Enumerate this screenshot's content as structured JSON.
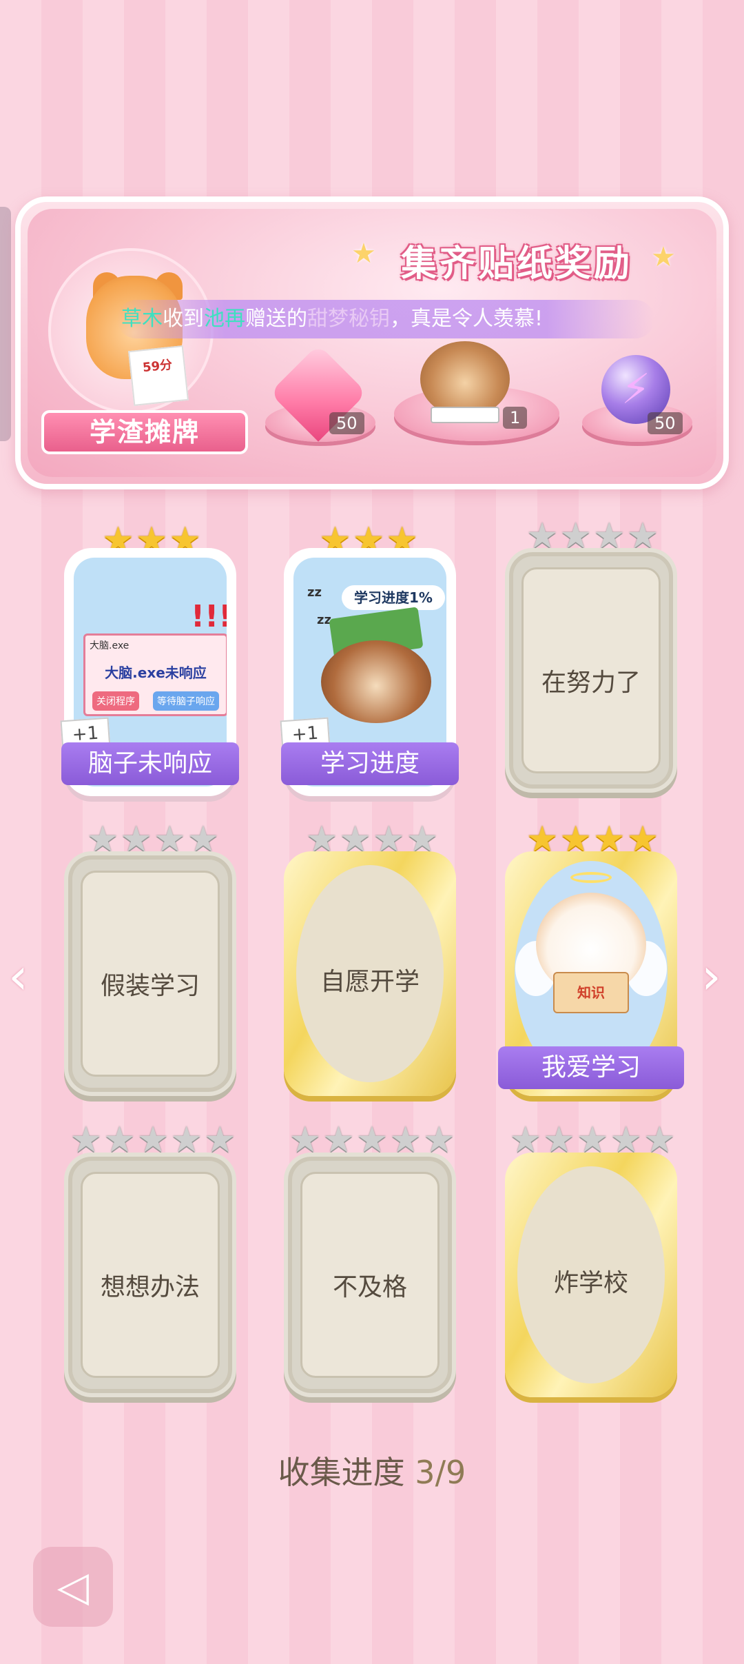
{
  "banner": {
    "title": "集齐贴纸奖励",
    "ticker": {
      "name1": "草木",
      "text1": "收到",
      "name2": "池再",
      "text2": "赠送的",
      "gift": "甜梦秘钥",
      "text3": "，真是令人羡慕!"
    },
    "tiger": {
      "paper_score": "59分",
      "label": "学渣摊牌"
    },
    "rewards": [
      {
        "icon": "heart-gem-icon",
        "count": "50"
      },
      {
        "icon": "monkey-reading-icon",
        "count": "1"
      },
      {
        "icon": "lightning-orb-icon",
        "count": "50"
      }
    ]
  },
  "cards": [
    {
      "label": "脑子未响应",
      "stars": 3,
      "max_stars": 3,
      "state": "unlocked",
      "plus": "+1",
      "art": {
        "window_title": "大脑.exe",
        "message": "大脑.exe未响应",
        "btn1": "关闭程序",
        "btn2": "等待脑子响应",
        "exclaim": "!!!"
      }
    },
    {
      "label": "学习进度",
      "stars": 3,
      "max_stars": 3,
      "state": "unlocked",
      "plus": "+1",
      "art": {
        "bubble": "学习进度1%",
        "zz": "zz"
      }
    },
    {
      "label": "在努力了",
      "stars": 0,
      "max_stars": 4,
      "state": "locked"
    },
    {
      "label": "假装学习",
      "stars": 0,
      "max_stars": 4,
      "state": "locked"
    },
    {
      "label": "自愿开学",
      "stars": 0,
      "max_stars": 4,
      "state": "locked-gold"
    },
    {
      "label": "我爱学习",
      "stars": 4,
      "max_stars": 4,
      "state": "unlocked",
      "art": {
        "book": "知识"
      }
    },
    {
      "label": "想想办法",
      "stars": 0,
      "max_stars": 5,
      "state": "locked"
    },
    {
      "label": "不及格",
      "stars": 0,
      "max_stars": 5,
      "state": "locked"
    },
    {
      "label": "炸学校",
      "stars": 0,
      "max_stars": 5,
      "state": "locked-gold"
    }
  ],
  "collection": {
    "label": "收集进度",
    "value": "3/9"
  },
  "nav": {
    "prev_icon": "chevron-left-icon",
    "next_icon": "chevron-right-icon",
    "back_icon": "back-arrow-icon"
  },
  "colors": {
    "background_stripe_a": "#fbd6e1",
    "background_stripe_b": "#f9cbd9",
    "ribbon_purple": "#8a5bd8",
    "star_gold": "#f7c530",
    "star_grey": "#cfcfcf"
  }
}
